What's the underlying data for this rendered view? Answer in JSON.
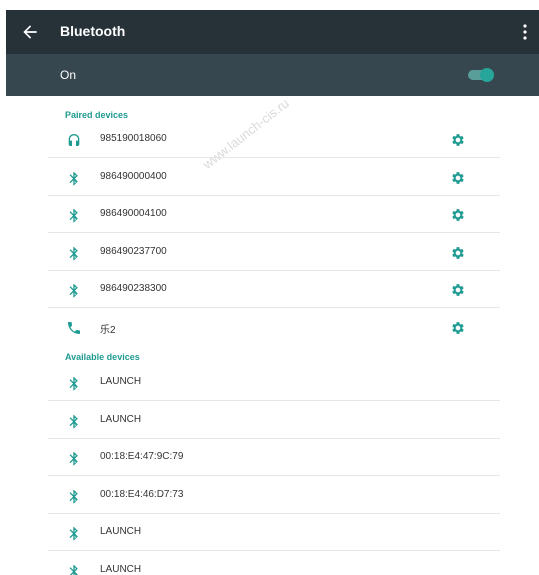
{
  "header": {
    "title": "Bluetooth",
    "back_icon": "arrow-back-icon",
    "menu_icon": "overflow-menu-icon"
  },
  "bluetooth_toggle": {
    "label": "On",
    "state": "on",
    "accent_color": "#26a69a"
  },
  "watermark": "www.launch-cis.ru",
  "paired": {
    "header": "Paired devices",
    "items": [
      {
        "name": "985190018060",
        "icon": "headphones-icon"
      },
      {
        "name": "986490000400",
        "icon": "bluetooth-icon"
      },
      {
        "name": "986490004100",
        "icon": "bluetooth-icon"
      },
      {
        "name": "986490237700",
        "icon": "bluetooth-icon"
      },
      {
        "name": "986490238300",
        "icon": "bluetooth-icon"
      },
      {
        "name": "乐2",
        "icon": "phone-icon"
      }
    ]
  },
  "available": {
    "header": "Available devices",
    "items": [
      {
        "name": "LAUNCH",
        "icon": "bluetooth-icon"
      },
      {
        "name": "LAUNCH",
        "icon": "bluetooth-icon"
      },
      {
        "name": "00:18:E4:47:9C:79",
        "icon": "bluetooth-icon"
      },
      {
        "name": "00:18:E4:46:D7:73",
        "icon": "bluetooth-icon"
      },
      {
        "name": "LAUNCH",
        "icon": "bluetooth-icon"
      },
      {
        "name": "LAUNCH",
        "icon": "bluetooth-icon"
      }
    ]
  },
  "colors": {
    "appbar": "#263238",
    "toggle_bar": "#37474f",
    "accent": "#1f9b91"
  }
}
